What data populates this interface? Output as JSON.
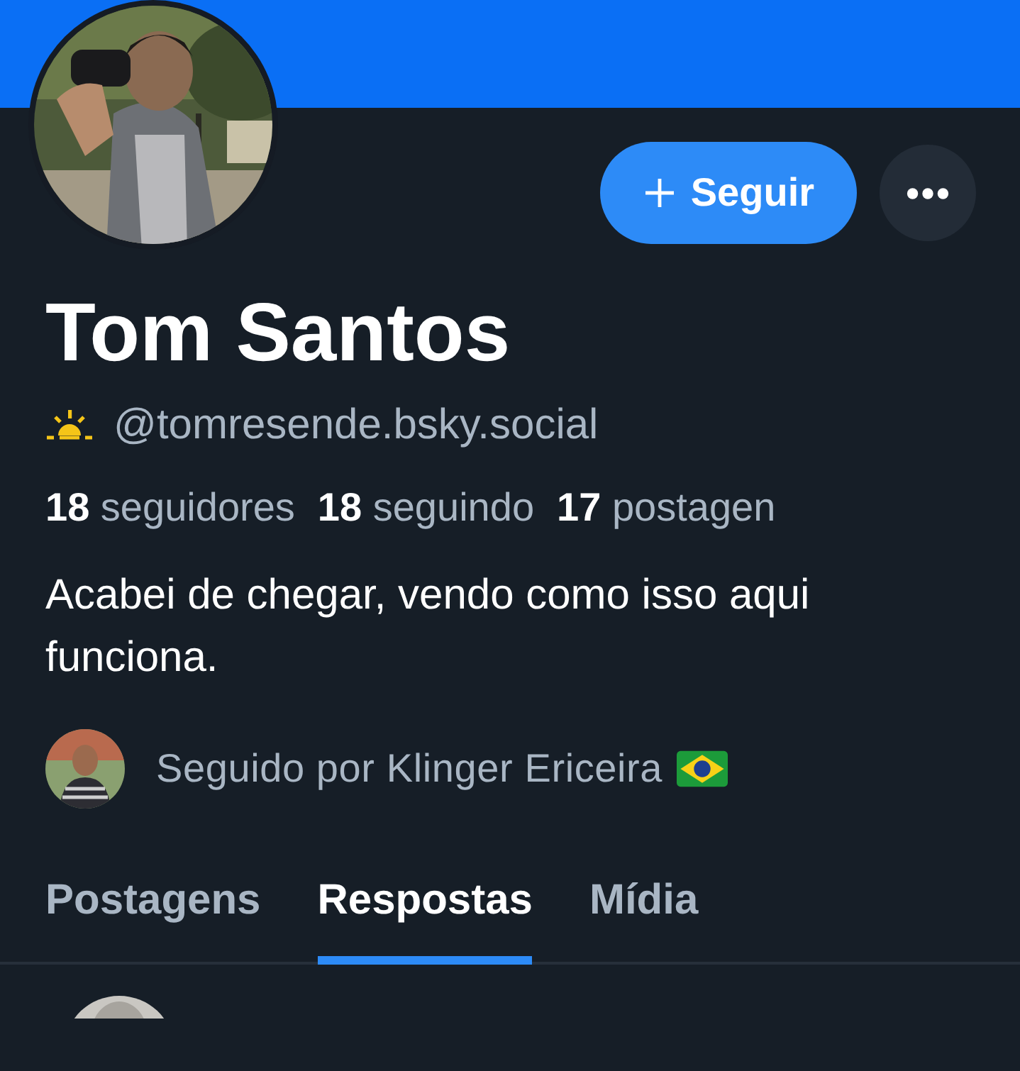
{
  "profile": {
    "name": "Tom Santos",
    "handle": "@tomresende.bsky.social",
    "stats": [
      {
        "count": "18",
        "label": "seguidores"
      },
      {
        "count": "18",
        "label": "seguindo"
      },
      {
        "count": "17",
        "label": "postagen"
      }
    ],
    "bio": "Acabei de chegar, vendo como isso aqui funciona.",
    "followed_by": "Seguido por Klinger Ericeira"
  },
  "follow_button": {
    "label": "Seguir"
  },
  "tabs": [
    {
      "label": "Postagens",
      "selected": false
    },
    {
      "label": "Respostas",
      "selected": true
    },
    {
      "label": "Mídia",
      "selected": false
    }
  ]
}
